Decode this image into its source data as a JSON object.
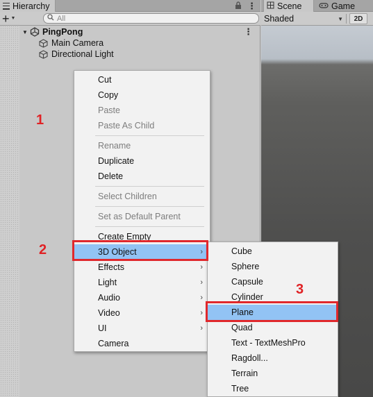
{
  "hierarchy": {
    "tab_label": "Hierarchy",
    "search_placeholder": "All",
    "scene_name": "PingPong",
    "objects": [
      "Main Camera",
      "Directional Light"
    ]
  },
  "scene_panel": {
    "tabs": [
      "Scene",
      "Game"
    ],
    "shading_mode": "Shaded",
    "toggle_2d": "2D"
  },
  "context_menu": {
    "items": [
      {
        "label": "Cut",
        "enabled": true
      },
      {
        "label": "Copy",
        "enabled": true
      },
      {
        "label": "Paste",
        "enabled": false
      },
      {
        "label": "Paste As Child",
        "enabled": false
      },
      {
        "label": "Rename",
        "enabled": false
      },
      {
        "label": "Duplicate",
        "enabled": true
      },
      {
        "label": "Delete",
        "enabled": true
      },
      {
        "label": "Select Children",
        "enabled": false
      },
      {
        "label": "Set as Default Parent",
        "enabled": false
      },
      {
        "label": "Create Empty",
        "enabled": true
      },
      {
        "label": "3D Object",
        "enabled": true,
        "submenu": true,
        "highlighted": true
      },
      {
        "label": "Effects",
        "enabled": true,
        "submenu": true
      },
      {
        "label": "Light",
        "enabled": true,
        "submenu": true
      },
      {
        "label": "Audio",
        "enabled": true,
        "submenu": true
      },
      {
        "label": "Video",
        "enabled": true,
        "submenu": true
      },
      {
        "label": "UI",
        "enabled": true,
        "submenu": true
      },
      {
        "label": "Camera",
        "enabled": true
      }
    ]
  },
  "submenu_3d_object": {
    "items": [
      "Cube",
      "Sphere",
      "Capsule",
      "Cylinder",
      "Plane",
      "Quad",
      "Text - TextMeshPro",
      "Ragdoll...",
      "Terrain",
      "Tree"
    ],
    "highlighted": "Plane"
  },
  "annotations": {
    "step1": "1",
    "step2": "2",
    "step3": "3",
    "color": "#e0282c"
  },
  "colors": {
    "menu_highlight": "#92c3f4",
    "panel_bg": "#c8c8c8"
  }
}
